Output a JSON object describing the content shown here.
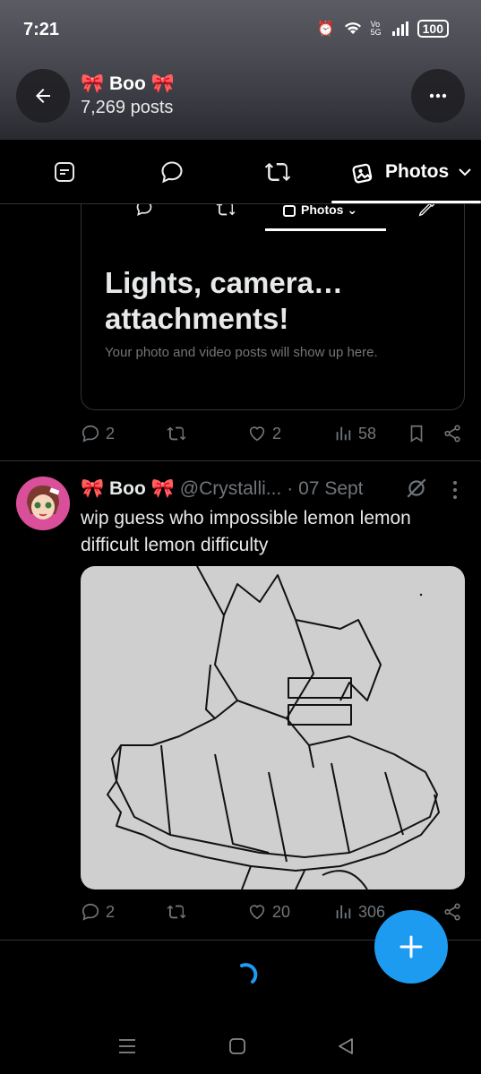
{
  "status": {
    "time": "7:21",
    "network": "Vo 5G",
    "battery": "100"
  },
  "profile": {
    "name": "🎀 Boo 🎀",
    "posts": "7,269 posts"
  },
  "tabs": {
    "active_label": "Photos"
  },
  "embed": {
    "tab_label": "Photos",
    "heading": "Lights, camera… attachments!",
    "subtext": "Your photo and video posts will show up here."
  },
  "post1_stats": {
    "replies": "2",
    "likes": "2",
    "views": "58"
  },
  "post2": {
    "name": "🎀 Boo 🎀",
    "handle": "@Crystalli...",
    "date": "· 07 Sept",
    "text": "wip guess who impossible lemon lemon difficult lemon difficulty",
    "replies": "2",
    "likes": "20",
    "views": "306"
  },
  "colors": {
    "accent": "#1d9bf0",
    "muted": "#71767b",
    "background": "#000000"
  }
}
